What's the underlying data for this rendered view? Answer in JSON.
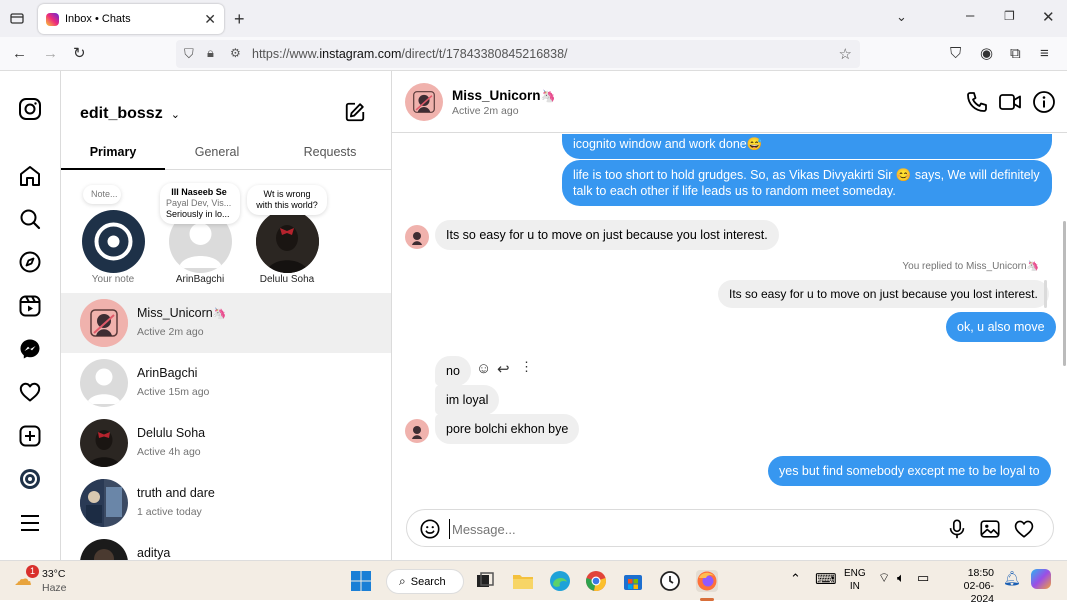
{
  "browser": {
    "tab_title": "Inbox • Chats",
    "url_prefix": "https://www.",
    "url_domain": "instagram.com",
    "url_path": "/direct/t/17843380845216838/"
  },
  "inbox": {
    "username": "edit_bossz",
    "tabs": [
      "Primary",
      "General",
      "Requests"
    ],
    "notes": [
      {
        "bubble": "Note...",
        "caption": "Your note"
      },
      {
        "bubble_title": "III Naseeb Se",
        "bubble_line1": "Payal Dev, Vis...",
        "bubble_line2": "Seriously in lo...",
        "caption": "ArinBagchi"
      },
      {
        "bubble_line1": "Wt is wrong",
        "bubble_line2": "with this world?",
        "caption": "Delulu Soha"
      }
    ],
    "conversations": [
      {
        "name": "Miss_Unicorn",
        "emoji": "🦄",
        "status": "Active 2m ago"
      },
      {
        "name": "ArinBagchi",
        "status": "Active 15m ago"
      },
      {
        "name": "Delulu Soha",
        "status": "Active 4h ago"
      },
      {
        "name": "truth and dare",
        "status": "1 active today"
      },
      {
        "name": "aditya",
        "status": ""
      }
    ]
  },
  "chat": {
    "contact_name": "Miss_Unicorn",
    "contact_emoji": "🦄",
    "contact_status": "Active 2m ago",
    "messages": {
      "out1_partial": "icognito window and work done😅",
      "out2": "life is too short to hold grudges. So, as Vikas Divyakirti Sir 😊 says, We will definitely talk to each other if life leads us to random meet someday.",
      "in1": "Its so easy for u to move on just because you lost interest.",
      "reply_label": "You replied to Miss_Unicorn🦄",
      "reply_quote": "Its so easy for u to move on just because you lost interest.",
      "out3": "ok, u also move",
      "in2": "no",
      "in3": "im loyal",
      "in4": "pore bolchi ekhon bye",
      "out4": "yes but find somebody except me to be loyal to"
    },
    "composer_placeholder": "Message..."
  },
  "taskbar": {
    "temperature": "33°C",
    "weather": "Haze",
    "weather_badge": "1",
    "search_label": "Search",
    "lang_line1": "ENG",
    "lang_line2": "IN",
    "time": "18:50",
    "date": "02-06-2024"
  },
  "colors": {
    "accent_blue": "#3797f0",
    "incoming_gray": "#efefef"
  }
}
